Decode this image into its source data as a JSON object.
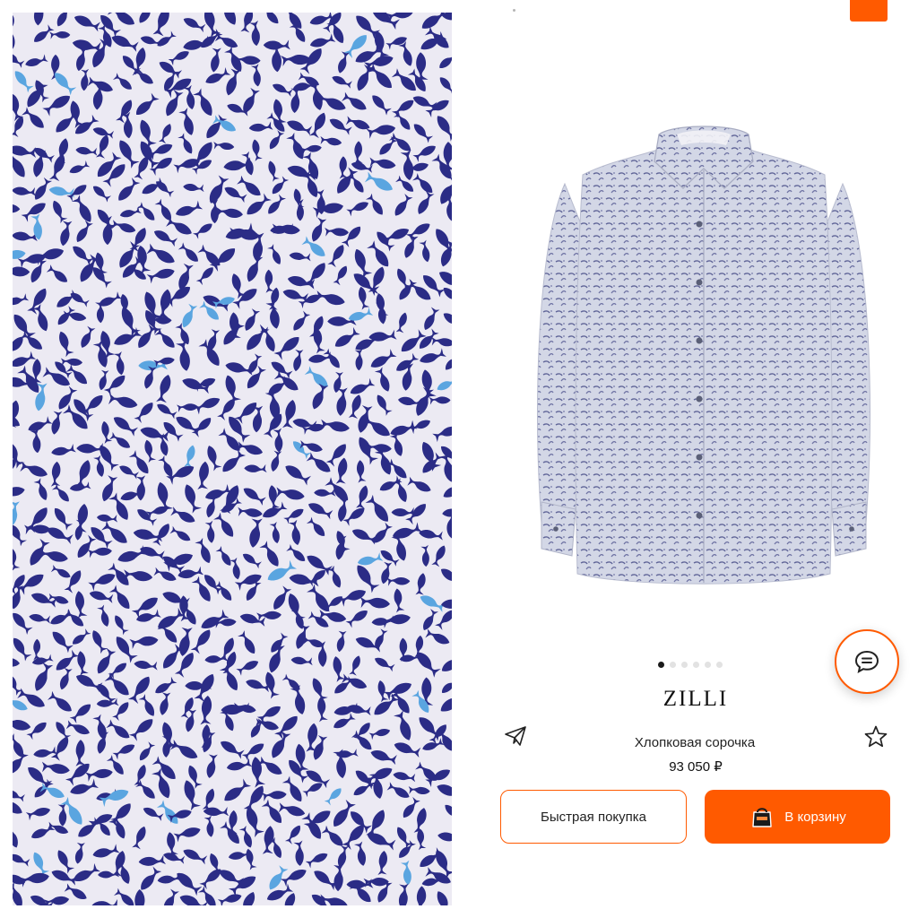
{
  "product": {
    "brand": "ZILLI",
    "name": "Хлопковая сорочка",
    "price": "93 050 ₽"
  },
  "gallery": {
    "total_images": 6,
    "active_index": 0
  },
  "actions": {
    "quick_buy_label": "Быстрая покупка",
    "add_to_cart_label": "В корзину"
  },
  "icons": {
    "share": "paper-plane-icon",
    "favorite": "star-outline-icon",
    "chat": "chat-bubble-icon",
    "cart": "shopping-bag-icon"
  },
  "colors": {
    "accent": "#ff5a00",
    "fish_dark": "#2b2c86",
    "fish_light": "#5aa5e0",
    "fabric_bg": "#eceaf3",
    "shirt": "#c9cde0"
  }
}
